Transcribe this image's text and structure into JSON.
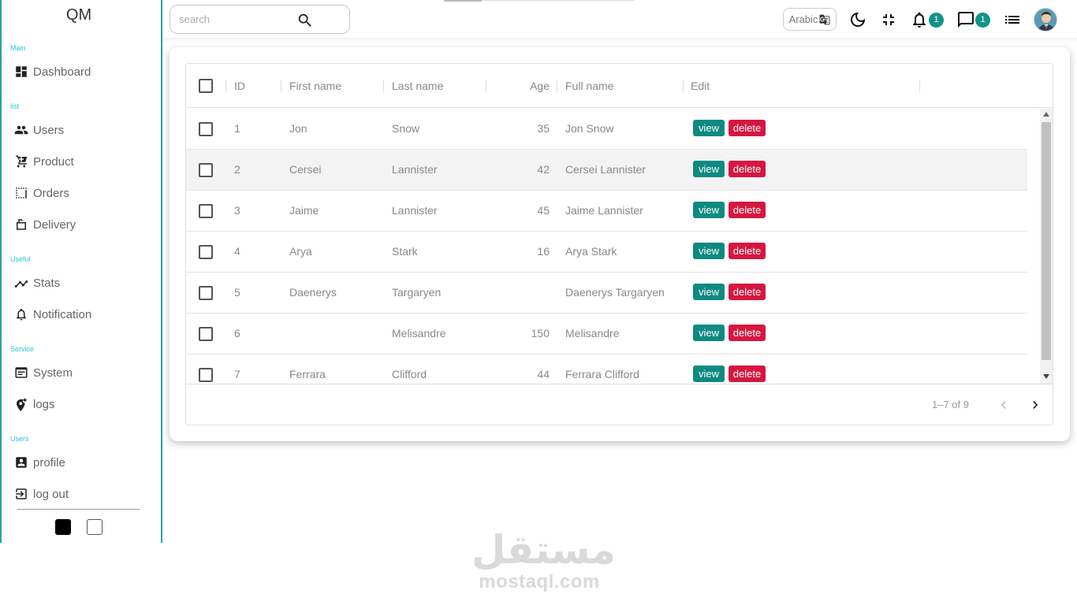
{
  "app": {
    "logo": "QM"
  },
  "sidebar": {
    "sections": [
      {
        "title": "Main",
        "items": [
          {
            "label": "Dashboard",
            "icon": "dashboard-icon"
          }
        ]
      },
      {
        "title": "list",
        "items": [
          {
            "label": "Users",
            "icon": "users-icon"
          },
          {
            "label": "Product",
            "icon": "cart-icon"
          },
          {
            "label": "Orders",
            "icon": "orders-icon"
          },
          {
            "label": "Delivery",
            "icon": "delivery-icon"
          }
        ]
      },
      {
        "title": "Useful",
        "items": [
          {
            "label": "Stats",
            "icon": "stats-icon"
          },
          {
            "label": "Notification",
            "icon": "notification-icon"
          }
        ]
      },
      {
        "title": "Service",
        "items": [
          {
            "label": "System",
            "icon": "system-icon"
          },
          {
            "label": "logs",
            "icon": "logs-icon"
          }
        ]
      },
      {
        "title": "Users",
        "items": [
          {
            "label": "profile",
            "icon": "profile-icon"
          },
          {
            "label": "log out",
            "icon": "logout-icon"
          }
        ]
      }
    ],
    "theme_colors": [
      "#000000",
      "#ffffff"
    ]
  },
  "topbar": {
    "search_placeholder": "search",
    "language_label": "Arabic",
    "notification_count": "1",
    "message_count": "1",
    "accent": "#12938a"
  },
  "table": {
    "columns": {
      "id": "ID",
      "first": "First name",
      "last": "Last name",
      "age": "Age",
      "full": "Full name",
      "edit": "Edit"
    },
    "rows": [
      {
        "id": "1",
        "first": "Jon",
        "last": "Snow",
        "age": "35",
        "full": "Jon Snow"
      },
      {
        "id": "2",
        "first": "Cersei",
        "last": "Lannister",
        "age": "42",
        "full": "Cersei Lannister"
      },
      {
        "id": "3",
        "first": "Jaime",
        "last": "Lannister",
        "age": "45",
        "full": "Jaime Lannister"
      },
      {
        "id": "4",
        "first": "Arya",
        "last": "Stark",
        "age": "16",
        "full": "Arya Stark"
      },
      {
        "id": "5",
        "first": "Daenerys",
        "last": "Targaryen",
        "age": "",
        "full": "Daenerys Targaryen"
      },
      {
        "id": "6",
        "first": "",
        "last": "Melisandre",
        "age": "150",
        "full": "Melisandre"
      },
      {
        "id": "7",
        "first": "Ferrara",
        "last": "Clifford",
        "age": "44",
        "full": "Ferrara Clifford"
      }
    ],
    "view_label": "view",
    "delete_label": "delete",
    "view_color": "#0e8a80",
    "delete_color": "#d5173f",
    "pagination": "1–7 of 9"
  },
  "watermark": {
    "arabic": "مستقل",
    "latin": "mostaql.com"
  }
}
